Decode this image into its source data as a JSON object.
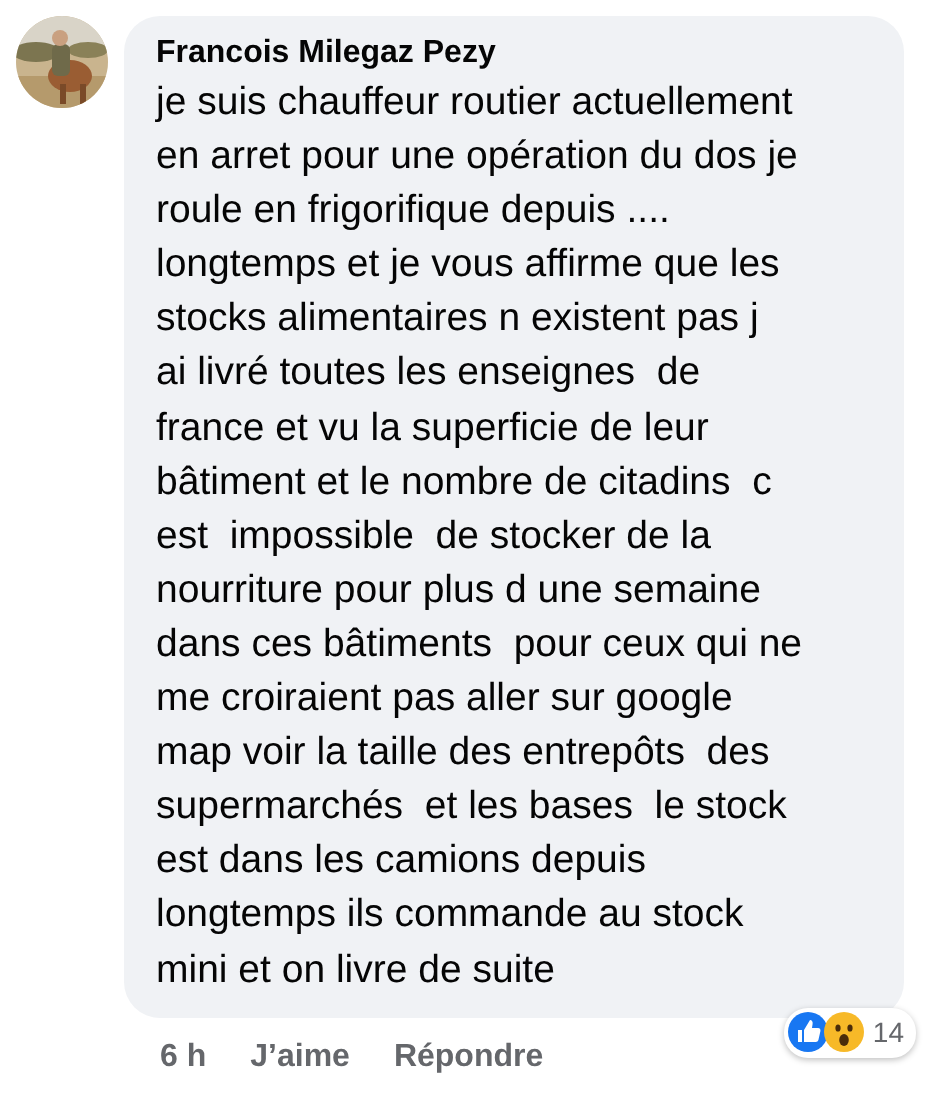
{
  "comment": {
    "author": "Francois Milegaz Pezy",
    "text": "je suis chauffeur routier actuellement\nen arret pour une opération du dos je\nroule en frigorifique depuis ....\nlongtemps et je vous affirme que les\nstocks alimentaires n existent pas j\nai livré toutes les enseignes  de\nfrance et vu la superficie de leur\nbâtiment et le nombre de citadins  c\nest  impossible  de stocker de la\nnourriture pour plus d une semaine\ndans ces bâtiments  pour ceux qui ne\nme croiraient pas aller sur google\nmap voir la taille des entrepôts  des\nsupermarchés  et les bases  le stock\nest dans les camions depuis\nlongtemps ils commande au stock\nmini et on livre de suite",
    "time": "6 h",
    "actions": [
      "J’aime",
      "Répondre"
    ],
    "reactions": [
      {
        "kind": "like"
      },
      {
        "kind": "wow"
      }
    ],
    "reaction_count": "14"
  }
}
